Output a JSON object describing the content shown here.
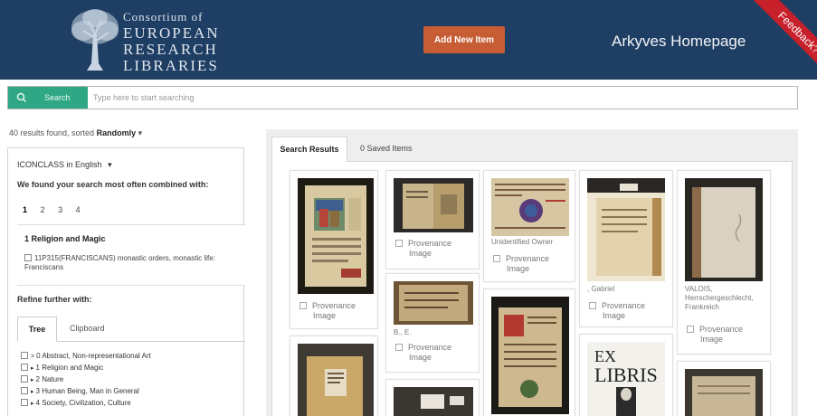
{
  "header": {
    "logo_line1": "Consortium of",
    "logo_line2": "EUROPEAN",
    "logo_line3": "RESEARCH",
    "logo_line4": "LIBRARIES",
    "add_button": "Add New Item",
    "home_link": "Arkyves Homepage",
    "feedback": "Feedback?"
  },
  "search": {
    "button_label": "Search",
    "placeholder": "Type here to start searching"
  },
  "results": {
    "count_text": "40 results found, sorted",
    "sort_value": "Randomly",
    "sort_caret": "▾"
  },
  "left": {
    "language": "ICONCLASS in English",
    "language_caret": "▾",
    "combined_heading": "We found your search most often combined with:",
    "pages": [
      "1",
      "2",
      "3",
      "4"
    ],
    "result_title": "1 Religion and Magic",
    "result_item": "11P315(FRANCISCANS) monastic orders, monastic life: Franciscans",
    "refine_heading": "Refine further with:",
    "tab_tree": "Tree",
    "tab_clipboard": "Clipboard",
    "tree_items": [
      {
        "arrow": ">",
        "label": "0 Abstract, Non-representational Art"
      },
      {
        "arrow": "▸",
        "label": "1 Religion and Magic"
      },
      {
        "arrow": "▸",
        "label": "2 Nature"
      },
      {
        "arrow": "▸",
        "label": "3 Human Being, Man in General"
      },
      {
        "arrow": "▸",
        "label": "4 Society, Civilization, Culture"
      }
    ]
  },
  "right": {
    "tab_results": "Search Results",
    "tab_saved": "0 Saved Items",
    "provenance_label_1": "Provenance",
    "provenance_label_2": "Image",
    "caption_unidentified": "Unidentified Owner",
    "caption_be": "B., E.",
    "caption_gabriel": ", Gabriel",
    "caption_valois_1": "VALOIS,",
    "caption_valois_2": "Herrschergeschlecht,",
    "caption_valois_3": "Frankreich",
    "bookplate_text_1": "EX",
    "bookplate_text_2": "LIBRIS"
  },
  "colors": {
    "header_bg": "#1f3e63",
    "add_button": "#c75d34",
    "search_button": "#2fa684",
    "feedback_ribbon": "#c8202b"
  }
}
